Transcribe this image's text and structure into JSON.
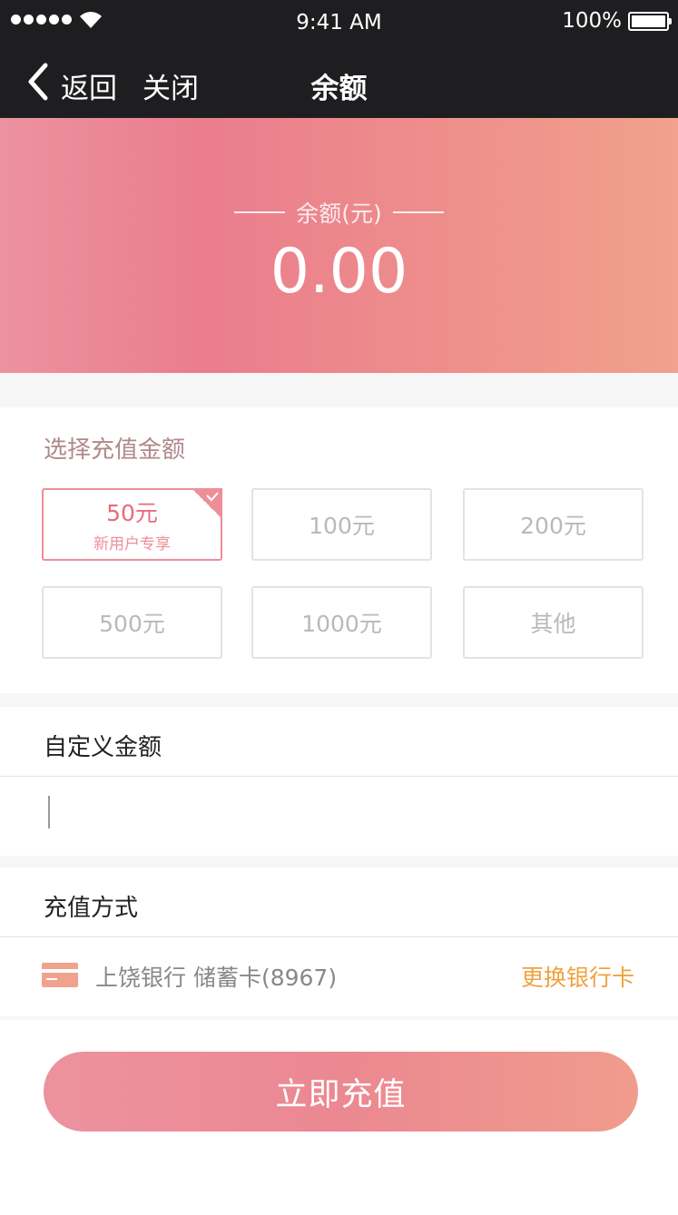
{
  "status_bar": {
    "time": "9:41 AM",
    "battery_percent": "100%"
  },
  "nav": {
    "back_label": "返回",
    "close_label": "关闭",
    "title": "余额"
  },
  "balance": {
    "label": "余额(元)",
    "amount": "0.00"
  },
  "recharge": {
    "title": "选择充值金额",
    "options": [
      {
        "label": "50元",
        "note": "新用户专享",
        "selected": true
      },
      {
        "label": "100元"
      },
      {
        "label": "200元"
      },
      {
        "label": "500元"
      },
      {
        "label": "1000元"
      },
      {
        "label": "其他"
      }
    ]
  },
  "custom": {
    "title": "自定义金额",
    "value": ""
  },
  "payment": {
    "title": "充值方式",
    "card_text": "上饶银行 储蓄卡(8967)",
    "change_label": "更换银行卡"
  },
  "submit_label": "立即充值",
  "colors": {
    "accent": "#ea7d8e",
    "link": "#f0a23f",
    "nav_bg": "#1e1e20"
  }
}
